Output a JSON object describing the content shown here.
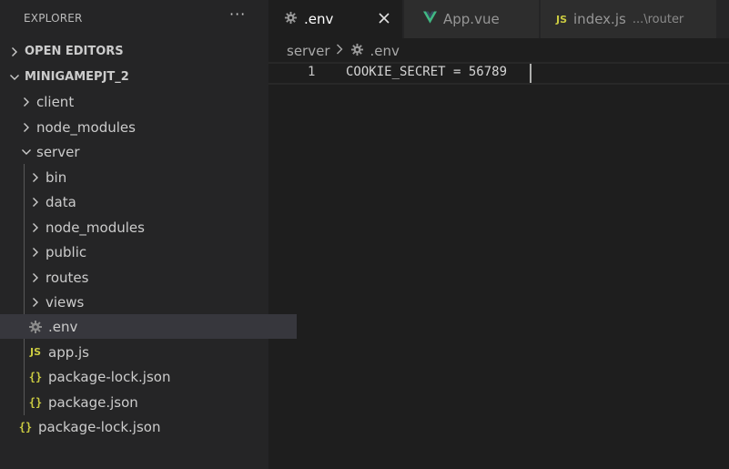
{
  "explorer": {
    "title": "EXPLORER",
    "more_label": "···"
  },
  "tree": {
    "open_editors": "OPEN EDITORS",
    "project": "MINIGAMEPJT_2",
    "items": [
      {
        "label": "client"
      },
      {
        "label": "node_modules"
      },
      {
        "label": "server"
      },
      {
        "label": "bin"
      },
      {
        "label": "data"
      },
      {
        "label": "node_modules"
      },
      {
        "label": "public"
      },
      {
        "label": "routes"
      },
      {
        "label": "views"
      },
      {
        "label": ".env"
      },
      {
        "label": "app.js"
      },
      {
        "label": "package-lock.json"
      },
      {
        "label": "package.json"
      },
      {
        "label": "package-lock.json"
      }
    ],
    "js_badge": "JS",
    "json_badge": "{}"
  },
  "tabs": [
    {
      "label": ".env"
    },
    {
      "label": "App.vue"
    },
    {
      "label": "index.js",
      "description": "...\\router",
      "badge": "JS"
    }
  ],
  "breadcrumb": {
    "folder": "server",
    "file": ".env"
  },
  "editor": {
    "line_number": "1",
    "code": "COOKIE_SECRET = 56789"
  },
  "colors": {
    "vue_green": "#41b883",
    "js_yellow": "#cbcb41",
    "selection": "#37373d"
  }
}
